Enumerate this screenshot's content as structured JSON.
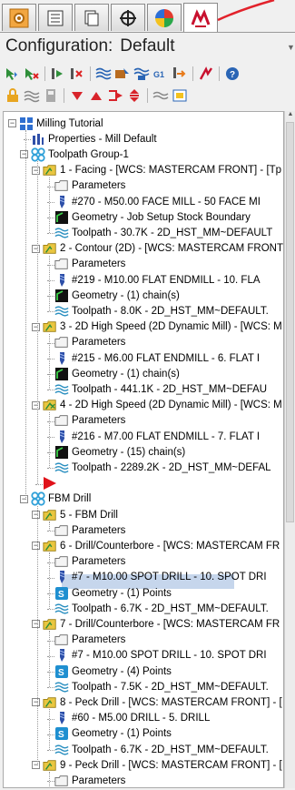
{
  "panel": {
    "configuration_label": "Configuration:",
    "configuration_value": "Default",
    "tabs": [
      {
        "name": "toolpaths-tab",
        "icon": "gear-tab-icon"
      },
      {
        "name": "list-tab",
        "icon": "list-icon"
      },
      {
        "name": "levels-tab",
        "icon": "layers-icon"
      },
      {
        "name": "planes-tab",
        "icon": "crosshair-icon"
      },
      {
        "name": "art-tab",
        "icon": "color-sphere-icon"
      },
      {
        "name": "mastercam-tab",
        "icon": "mastercam-logo-icon"
      }
    ]
  },
  "tree": {
    "rows": [
      {
        "label": "Milling Tutorial",
        "icon": "machine-group",
        "indent": 0
      },
      {
        "label": "Properties - Mill Default",
        "icon": "properties",
        "indent": 1
      },
      {
        "label": "Toolpath Group-1",
        "icon": "toolpath-group",
        "indent": 1
      },
      {
        "label": "1 - Facing - [WCS: MASTERCAM FRONT] - [Tp",
        "icon": "operation",
        "indent": 2
      },
      {
        "label": "Parameters",
        "icon": "parameters",
        "indent": 3
      },
      {
        "label": "#270 - M50.00 FACE MILL -  50 FACE MI",
        "icon": "tool",
        "indent": 3
      },
      {
        "label": "Geometry - Job Setup Stock Boundary",
        "icon": "geometry",
        "indent": 3
      },
      {
        "label": "Toolpath - 30.7K - 2D_HST_MM~DEFAULT",
        "icon": "toolpath",
        "indent": 3
      },
      {
        "label": "2 - Contour (2D) - [WCS: MASTERCAM FRONT",
        "icon": "operation",
        "indent": 2
      },
      {
        "label": "Parameters",
        "icon": "parameters",
        "indent": 3
      },
      {
        "label": "#219 - M10.00 FLAT ENDMILL -  10. FLA",
        "icon": "tool",
        "indent": 3
      },
      {
        "label": "Geometry - (1) chain(s)",
        "icon": "geometry",
        "indent": 3
      },
      {
        "label": "Toolpath - 8.0K - 2D_HST_MM~DEFAULT.",
        "icon": "toolpath",
        "indent": 3
      },
      {
        "label": "3 - 2D High Speed (2D Dynamic Mill) - [WCS: M",
        "icon": "operation",
        "indent": 2
      },
      {
        "label": "Parameters",
        "icon": "parameters",
        "indent": 3
      },
      {
        "label": "#215 - M6.00 FLAT ENDMILL -  6. FLAT I",
        "icon": "tool",
        "indent": 3
      },
      {
        "label": "Geometry - (1) chain(s)",
        "icon": "geometry",
        "indent": 3
      },
      {
        "label": "Toolpath - 441.1K - 2D_HST_MM~DEFAU",
        "icon": "toolpath",
        "indent": 3
      },
      {
        "label": "4 - 2D High Speed (2D Dynamic Mill) - [WCS: M",
        "icon": "operation-dirty",
        "indent": 2
      },
      {
        "label": "Parameters",
        "icon": "parameters",
        "indent": 3
      },
      {
        "label": "#216 - M7.00 FLAT ENDMILL -  7. FLAT I",
        "icon": "tool",
        "indent": 3
      },
      {
        "label": "Geometry - (15) chain(s)",
        "icon": "geometry",
        "indent": 3
      },
      {
        "label": "Toolpath - 2289.2K - 2D_HST_MM~DEFAL",
        "icon": "toolpath",
        "indent": 3
      },
      {
        "label": "",
        "icon": "insert-arrow",
        "indent": 2
      },
      {
        "label": "FBM Drill",
        "icon": "toolpath-group",
        "indent": 1
      },
      {
        "label": "5 - FBM Drill",
        "icon": "operation",
        "indent": 2
      },
      {
        "label": "Parameters",
        "icon": "parameters",
        "indent": 3
      },
      {
        "label": "6 - Drill/Counterbore - [WCS: MASTERCAM FR",
        "icon": "operation",
        "indent": 2
      },
      {
        "label": "Parameters",
        "icon": "parameters",
        "indent": 3
      },
      {
        "label": "#7 - M10.00 SPOT DRILL -  10. SPOT DRI",
        "icon": "tool",
        "indent": 3
      },
      {
        "label": "Geometry - (1) Points",
        "icon": "geometry-points",
        "indent": 3
      },
      {
        "label": "Toolpath - 6.7K - 2D_HST_MM~DEFAULT.",
        "icon": "toolpath",
        "indent": 3
      },
      {
        "label": "7 - Drill/Counterbore - [WCS: MASTERCAM FR",
        "icon": "operation",
        "indent": 2
      },
      {
        "label": "Parameters",
        "icon": "parameters",
        "indent": 3
      },
      {
        "label": "#7 - M10.00 SPOT DRILL -  10. SPOT DRI",
        "icon": "tool",
        "indent": 3
      },
      {
        "label": "Geometry - (4) Points",
        "icon": "geometry-points",
        "indent": 3
      },
      {
        "label": "Toolpath - 7.5K - 2D_HST_MM~DEFAULT.",
        "icon": "toolpath",
        "indent": 3
      },
      {
        "label": "8 - Peck Drill - [WCS: MASTERCAM FRONT] - [",
        "icon": "operation",
        "indent": 2
      },
      {
        "label": "#60 - M5.00 DRILL -  5. DRILL",
        "icon": "tool",
        "indent": 3
      },
      {
        "label": "Geometry - (1) Points",
        "icon": "geometry-points",
        "indent": 3
      },
      {
        "label": "Toolpath - 6.7K - 2D_HST_MM~DEFAULT.",
        "icon": "toolpath",
        "indent": 3
      },
      {
        "label": "9 - Peck Drill - [WCS: MASTERCAM FRONT] - [",
        "icon": "operation",
        "indent": 2
      },
      {
        "label": "Parameters",
        "icon": "parameters",
        "indent": 3
      },
      {
        "label": "#110 - M10.00 DRILL -  10. DRILL",
        "icon": "tool",
        "indent": 3
      }
    ]
  }
}
